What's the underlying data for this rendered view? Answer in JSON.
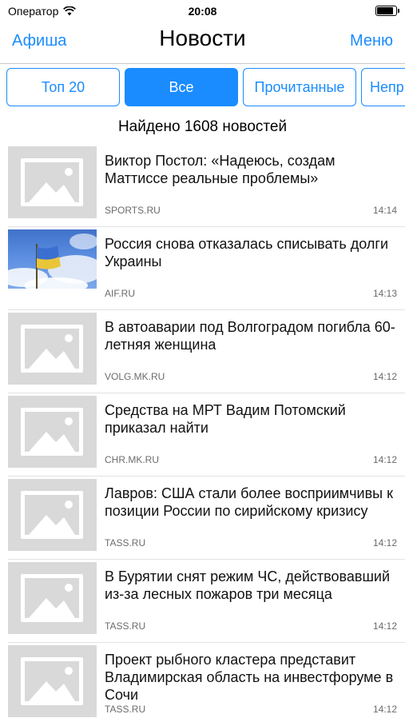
{
  "status_bar": {
    "carrier": "Оператор",
    "time": "20:08",
    "battery_level": 0.95,
    "icons": [
      "wifi-icon",
      "battery-icon"
    ]
  },
  "nav": {
    "left": "Афиша",
    "title": "Новости",
    "right": "Меню"
  },
  "segments": [
    {
      "label": "Топ 20",
      "active": false
    },
    {
      "label": "Все",
      "active": true
    },
    {
      "label": "Прочитанные",
      "active": false
    },
    {
      "label": "Непр",
      "active": false
    }
  ],
  "found_count": "Найдено 1608 новостей",
  "accent_color": "#1a8cff",
  "news": [
    {
      "title": "Виктор Постол: «Надеюсь, создам Маттиссе реальные проблемы»",
      "source": "SPORTS.RU",
      "time": "14:14",
      "image": "placeholder-image-icon"
    },
    {
      "title": "Россия снова отказалась списывать долги Украины",
      "source": "AIF.RU",
      "time": "14:13",
      "image": "flag-photo"
    },
    {
      "title": "В автоаварии под Волгоградом погибла 60-летняя женщина",
      "source": "VOLG.MK.RU",
      "time": "14:12",
      "image": "placeholder-image-icon"
    },
    {
      "title": "Средства на МРТ Вадим Потомский приказал найти",
      "source": "CHR.MK.RU",
      "time": "14:12",
      "image": "placeholder-image-icon"
    },
    {
      "title": "Лавров: США стали более восприимчивы к позиции России по сирийскому кризису",
      "source": "TASS.RU",
      "time": "14:12",
      "image": "placeholder-image-icon"
    },
    {
      "title": "В Бурятии снят режим ЧС, действовавший из-за лесных пожаров три месяца",
      "source": "TASS.RU",
      "time": "14:12",
      "image": "placeholder-image-icon"
    },
    {
      "title": "Проект рыбного кластера представит Владимирская область на инвестфоруме в Сочи",
      "source": "TASS.RU",
      "time": "14:12",
      "image": "placeholder-image-icon"
    }
  ]
}
